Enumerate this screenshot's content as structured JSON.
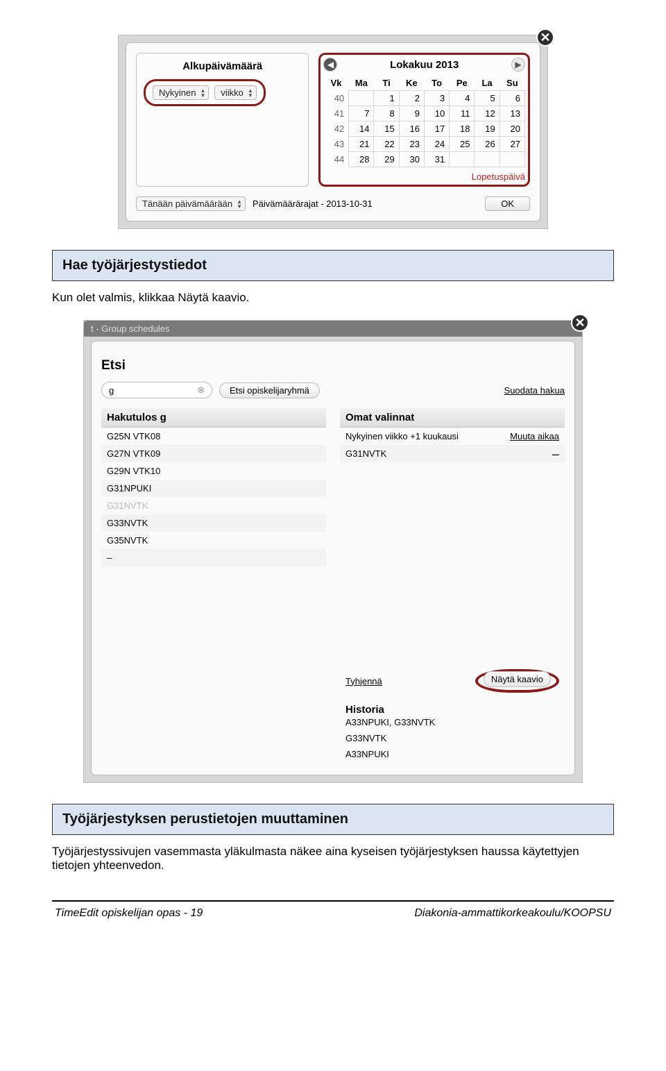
{
  "calendar_popup": {
    "left_title": "Alkupäivämäärä",
    "select_current": "Nykyinen",
    "select_unit": "viikko",
    "nav_prev": "◀",
    "nav_next": "▶",
    "month_title": "Lokakuu 2013",
    "dow": {
      "vk": "Vk",
      "ma": "Ma",
      "ti": "Ti",
      "ke": "Ke",
      "to": "To",
      "pe": "Pe",
      "la": "La",
      "su": "Su"
    },
    "weeks": [
      {
        "wk": "40",
        "cells": [
          "",
          "1",
          "2",
          "3",
          "4",
          "5",
          "6"
        ]
      },
      {
        "wk": "41",
        "cells": [
          "7",
          "8",
          "9",
          "10",
          "11",
          "12",
          "13"
        ]
      },
      {
        "wk": "42",
        "cells": [
          "14",
          "15",
          "16",
          "17",
          "18",
          "19",
          "20"
        ]
      },
      {
        "wk": "43",
        "cells": [
          "21",
          "22",
          "23",
          "24",
          "25",
          "26",
          "27"
        ]
      },
      {
        "wk": "44",
        "cells": [
          "28",
          "29",
          "30",
          "31",
          "",
          "",
          ""
        ]
      }
    ],
    "end_label": "Lopetuspäivä",
    "footer_select": "Tänään päivämäärään",
    "footer_range": "Päivämäärärajat - 2013-10-31",
    "ok": "OK"
  },
  "sections": {
    "hae_title": "Hae työjärjestystiedot",
    "hae_body": "Kun olet valmis, klikkaa Näytä kaavio.",
    "perus_title": "Työjärjestyksen perustietojen muuttaminen",
    "perus_body": "Työjärjestyssivujen vasemmasta yläkulmasta näkee aina kyseisen työjärjestyksen haussa käytettyjen tietojen yhteenvedon."
  },
  "etsi": {
    "tab": "t - Group schedules",
    "title": "Etsi",
    "input_value": "g",
    "clear_glyph": "⊗",
    "search_btn": "Etsi opiskelijaryhmä",
    "filter_link": "Suodata hakua",
    "results_header": "Hakutulos  g",
    "results": [
      "G25N VTK08",
      "G27N VTK09",
      "G29N VTK10",
      "G31NPUKI",
      "G31NVTK",
      "G33NVTK",
      "G35NVTK",
      "–"
    ],
    "results_dim_index": 4,
    "sel_header": "Omat valinnat",
    "sel_range": "Nykyinen viikko +1 kuukausi",
    "sel_change": "Muuta aikaa",
    "sel_item": "G31NVTK",
    "sel_remove": "–",
    "clear_link": "Tyhjennä",
    "show_btn": "Näytä kaavio",
    "history_title": "Historia",
    "history_line1": "A33NPUKI, G33NVTK",
    "history_line2": "G33NVTK",
    "history_line3": "A33NPUKI"
  },
  "footer": {
    "left": "TimeEdit opiskelijan opas - 19",
    "right": "Diakonia-ammattikorkeakoulu/KOOPSU"
  }
}
